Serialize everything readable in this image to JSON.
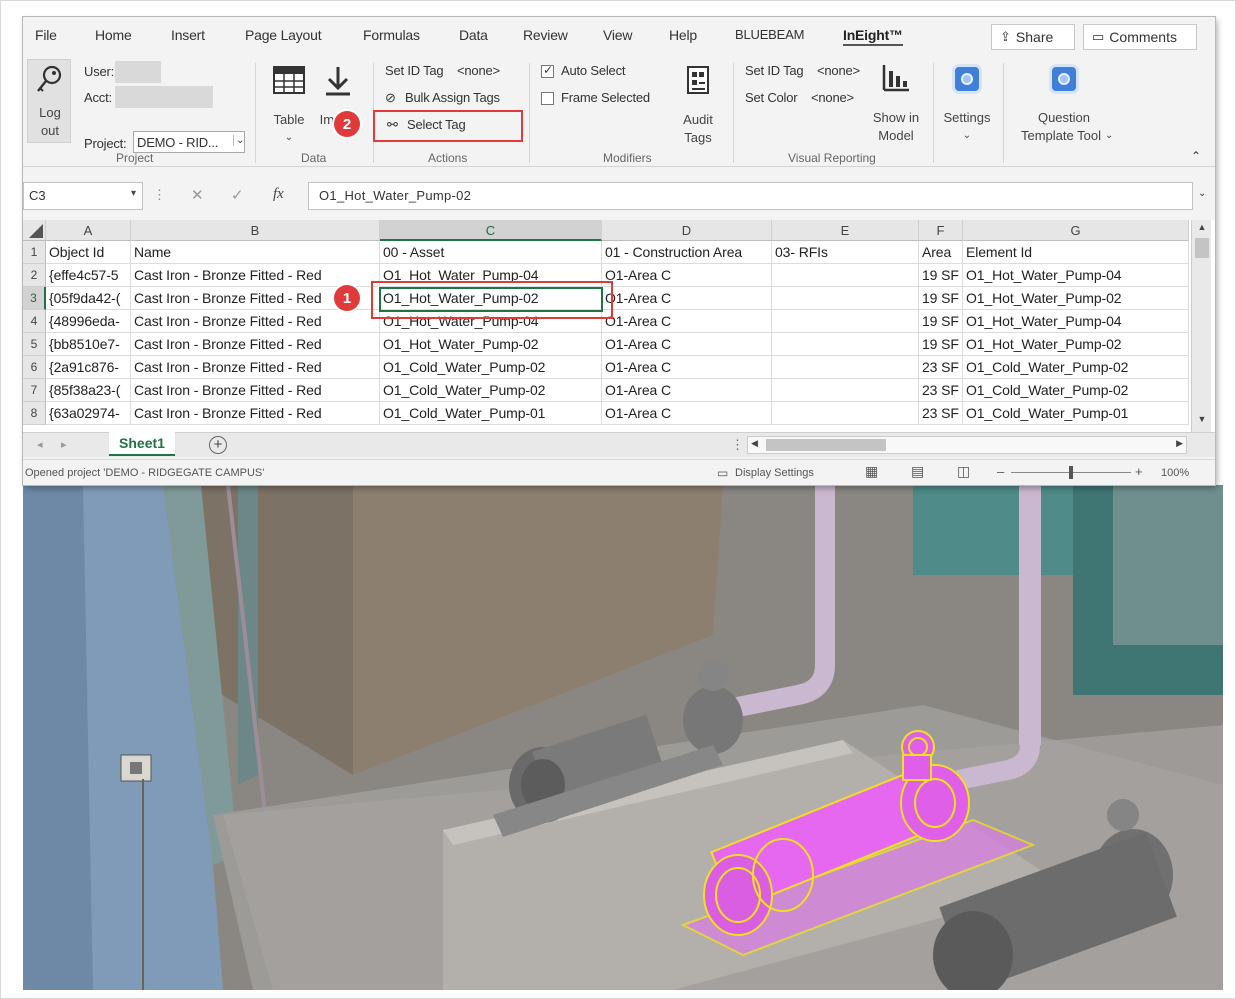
{
  "menu": {
    "tabs": [
      "File",
      "Home",
      "Insert",
      "Page Layout",
      "Formulas",
      "Data",
      "Review",
      "View",
      "Help",
      "BLUEBEAM",
      "InEight™"
    ],
    "share_label": "Share",
    "comments_label": "Comments"
  },
  "ribbon": {
    "project": {
      "logout_label_1": "Log",
      "logout_label_2": "out",
      "user_label": "User:",
      "acct_label": "Acct:",
      "project_label": "Project:",
      "project_value": "DEMO - RID...",
      "group_label": "Project"
    },
    "data": {
      "table_label": "Table",
      "import_label": "Import",
      "group_label": "Data"
    },
    "actions": {
      "set_id_tag_label": "Set ID Tag",
      "set_id_tag_value": "<none>",
      "bulk_assign_label": "Bulk Assign Tags",
      "select_tag_label": "Select Tag",
      "group_label": "Actions"
    },
    "modifiers": {
      "auto_select_label": "Auto Select",
      "auto_select_checked": true,
      "frame_selected_label": "Frame Selected",
      "frame_selected_checked": false,
      "audit_tags_label_1": "Audit",
      "audit_tags_label_2": "Tags",
      "group_label": "Modifiers"
    },
    "visual_reporting": {
      "set_id_tag_label": "Set ID Tag",
      "set_id_tag_value": "<none>",
      "set_color_label": "Set Color",
      "set_color_value": "<none>",
      "show_in_model_label_1": "Show in",
      "show_in_model_label_2": "Model",
      "group_label": "Visual Reporting"
    },
    "settings_label": "Settings",
    "question_template_label_1": "Question",
    "question_template_label_2": "Template Tool"
  },
  "formula_bar": {
    "name_box": "C3",
    "formula": "O1_Hot_Water_Pump-02"
  },
  "grid": {
    "columns": [
      "A",
      "B",
      "C",
      "D",
      "E",
      "F",
      "G"
    ],
    "rows": [
      [
        "1",
        "Object Id",
        "Name",
        "00 - Asset",
        "01 - Construction Area",
        "03- RFIs",
        "Area",
        "Element Id"
      ],
      [
        "2",
        "{effe4c57-5",
        "Cast Iron - Bronze Fitted - Red",
        "O1_Hot_Water_Pump-04",
        "O1-Area C",
        "",
        "19 SF",
        "O1_Hot_Water_Pump-04"
      ],
      [
        "3",
        "{05f9da42-(",
        "Cast Iron - Bronze Fitted - Red",
        "O1_Hot_Water_Pump-02",
        "O1-Area C",
        "",
        "19 SF",
        "O1_Hot_Water_Pump-02"
      ],
      [
        "4",
        "{48996eda-",
        "Cast Iron - Bronze Fitted - Red",
        "O1_Hot_Water_Pump-04",
        "O1-Area C",
        "",
        "19 SF",
        "O1_Hot_Water_Pump-04"
      ],
      [
        "5",
        "{bb8510e7-",
        "Cast Iron - Bronze Fitted - Red",
        "O1_Hot_Water_Pump-02",
        "O1-Area C",
        "",
        "19 SF",
        "O1_Hot_Water_Pump-02"
      ],
      [
        "6",
        "{2a91c876-",
        "Cast Iron - Bronze Fitted - Red",
        "O1_Cold_Water_Pump-02",
        "O1-Area C",
        "",
        "23 SF",
        "O1_Cold_Water_Pump-02"
      ],
      [
        "7",
        "{85f38a23-(",
        "Cast Iron - Bronze Fitted - Red",
        "O1_Cold_Water_Pump-02",
        "O1-Area C",
        "",
        "23 SF",
        "O1_Cold_Water_Pump-02"
      ],
      [
        "8",
        "{63a02974-",
        "Cast Iron - Bronze Fitted - Red",
        "O1_Cold_Water_Pump-01",
        "O1-Area C",
        "",
        "23 SF",
        "O1_Cold_Water_Pump-01"
      ]
    ],
    "selected_cell": "C3"
  },
  "sheet": {
    "tab_label": "Sheet1"
  },
  "status": {
    "message": "Opened project 'DEMO - RIDGEGATE CAMPUS'",
    "display_settings_label": "Display Settings",
    "zoom": "100%"
  },
  "annotations": {
    "step1": "1",
    "step2": "2"
  },
  "colors": {
    "excel_green": "#217346",
    "callout_red": "#e03b3b",
    "highlight_magenta": "#e667f0",
    "highlight_yellow": "#f0e020"
  }
}
